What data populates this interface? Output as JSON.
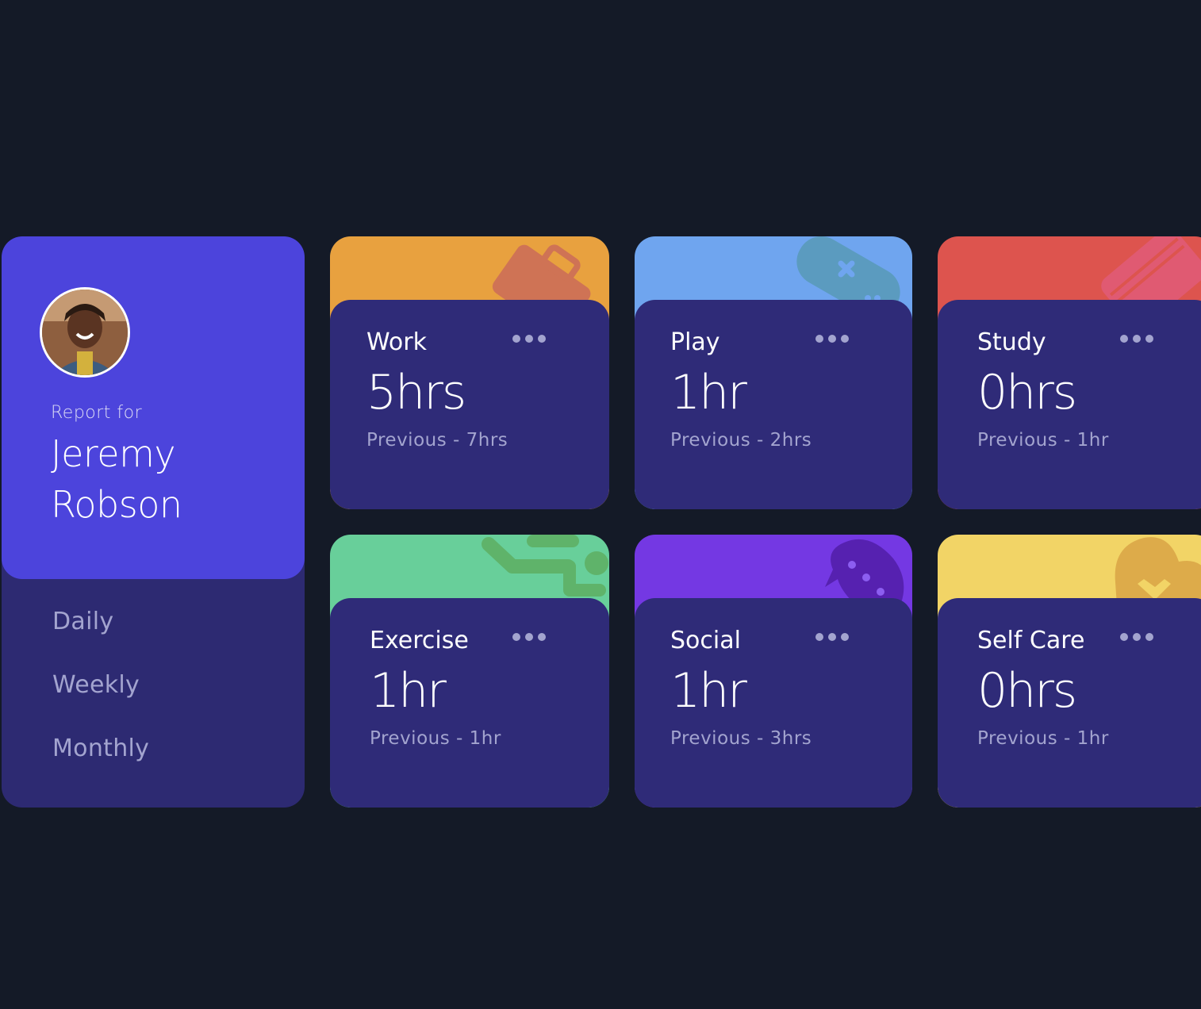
{
  "profile": {
    "report_for": "Report for",
    "name": "Jeremy Robson",
    "name_line1": "Jeremy",
    "name_line2": "Robson"
  },
  "periods": [
    "Daily",
    "Weekly",
    "Monthly"
  ],
  "cards": [
    {
      "title": "Work",
      "hours": "5hrs",
      "previous": "Previous - 7hrs",
      "color": "#e8a13f",
      "icon": "briefcase-icon"
    },
    {
      "title": "Play",
      "hours": "1hr",
      "previous": "Previous - 2hrs",
      "color": "#6fa5ef",
      "icon": "gamepad-icon"
    },
    {
      "title": "Study",
      "hours": "0hrs",
      "previous": "Previous - 1hr",
      "color": "#dd544e",
      "icon": "book-icon"
    },
    {
      "title": "Exercise",
      "hours": "1hr",
      "previous": "Previous - 1hr",
      "color": "#68cf9a",
      "icon": "running-icon"
    },
    {
      "title": "Social",
      "hours": "1hr",
      "previous": "Previous - 3hrs",
      "color": "#7438e3",
      "icon": "chat-icon"
    },
    {
      "title": "Self Care",
      "hours": "0hrs",
      "previous": "Previous - 1hr",
      "color": "#f2d466",
      "icon": "heart-icon"
    }
  ],
  "colors": {
    "background": "#141a27",
    "profile_accent": "#4c44dc",
    "card_body": "#2f2b78",
    "muted_text": "#a3a4cf"
  }
}
